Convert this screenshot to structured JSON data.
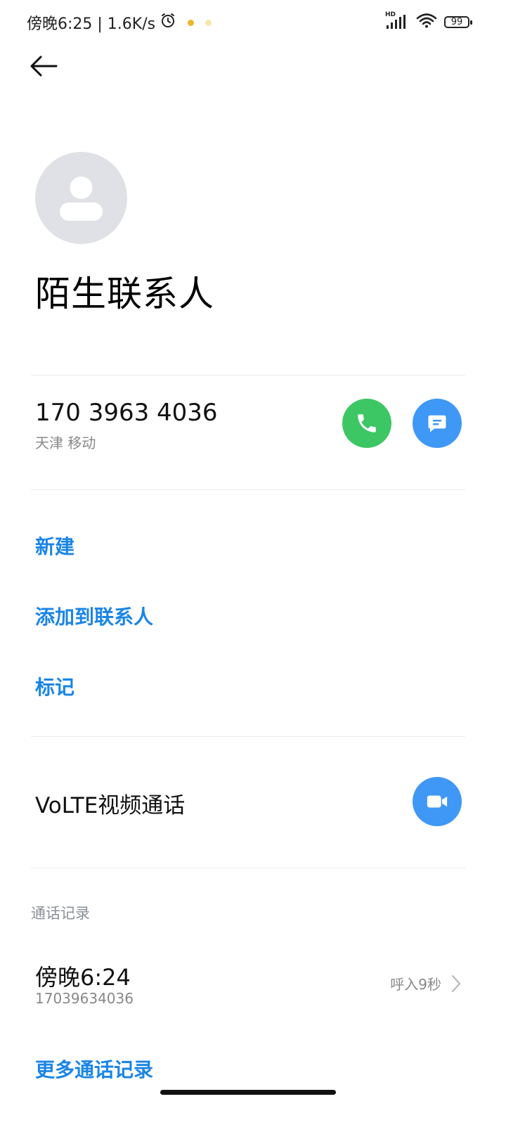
{
  "status_bar": {
    "time": "傍晚6:25 | 1.6K/s",
    "network_badge": "HD",
    "battery": "99",
    "icons": [
      "alarm-icon",
      "signal-icon",
      "wifi-icon",
      "battery-icon"
    ],
    "notification_dot_colors": [
      "#f1b52a",
      "#f6e7a8"
    ]
  },
  "contact": {
    "name": "陌生联系人",
    "number": "170 3963 4036",
    "location": "天津 移动"
  },
  "actions": {
    "new": "新建",
    "add_to_contacts": "添加到联系人",
    "mark": "标记"
  },
  "volte": {
    "label": "VoLTE视频通话"
  },
  "call_log": {
    "section_title": "通话记录",
    "entries": [
      {
        "time": "傍晚6:24",
        "number": "17039634036",
        "detail": "呼入9秒"
      }
    ],
    "more": "更多通话记录"
  },
  "colors": {
    "accent": "#1a85e6",
    "call_green": "#3cc764",
    "action_blue": "#3f97f6",
    "avatar_bg": "#dfe1e6"
  }
}
